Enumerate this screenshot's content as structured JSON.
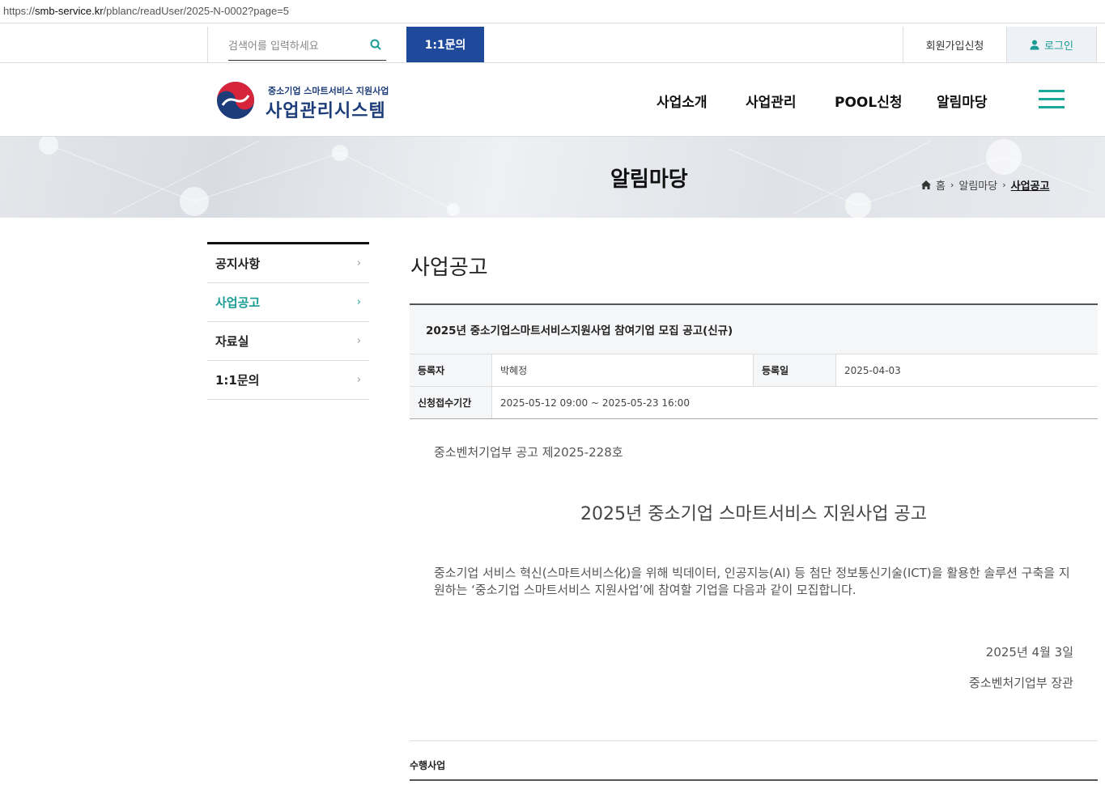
{
  "browser": {
    "url_prefix": "https://",
    "url_host": "smb-service.kr",
    "url_path": "/pblanc/readUser/2025-N-0002?page=5"
  },
  "topbar": {
    "search_placeholder": "검색어를 입력하세요",
    "inquiry_label": "1:1문의",
    "signup_label": "회원가입신청",
    "login_label": "로그인"
  },
  "header": {
    "logo_sub": "중소기업 스마트서비스 지원사업",
    "logo_main": "사업관리시스템",
    "nav": [
      "사업소개",
      "사업관리",
      "POOL신청",
      "알림마당"
    ]
  },
  "banner": {
    "title": "알림마당",
    "breadcrumb": [
      "홈",
      "알림마당",
      "사업공고"
    ]
  },
  "sidebar": {
    "items": [
      {
        "label": "공지사항",
        "active": false
      },
      {
        "label": "사업공고",
        "active": true
      },
      {
        "label": "자료실",
        "active": false
      },
      {
        "label": "1:1문의",
        "active": false
      }
    ]
  },
  "main": {
    "title": "사업공고",
    "post": {
      "title": "2025년 중소기업스마트서비스지원사업 참여기업 모집 공고(신규)",
      "author_label": "등록자",
      "author": "박혜정",
      "date_label": "등록일",
      "date": "2025-04-03",
      "period_label": "신청접수기간",
      "period": "2025-05-12 09:00 ~ 2025-05-23 16:00"
    },
    "body": {
      "notice_no": "중소벤처기업부 공고 제2025-228호",
      "doc_title": "2025년 중소기업 스마트서비스 지원사업 공고",
      "paragraph": "중소기업 서비스 혁신(스마트서비스化)을 위해 빅데이터, 인공지능(AI) 등 첨단 정보통신기술(ICT)을 활용한 솔루션 구축을 지원하는 ‘중소기업 스마트서비스 지원사업’에 참여할 기업을 다음과 같이 모집합니다.",
      "doc_date": "2025년 4월 3일",
      "doc_org": "중소벤처기업부 장관"
    },
    "section_label": "수행사업"
  },
  "colors": {
    "brand_blue": "#1f4a9c",
    "accent_teal": "#1a9b94",
    "logo_navy": "#1d3d7a"
  }
}
